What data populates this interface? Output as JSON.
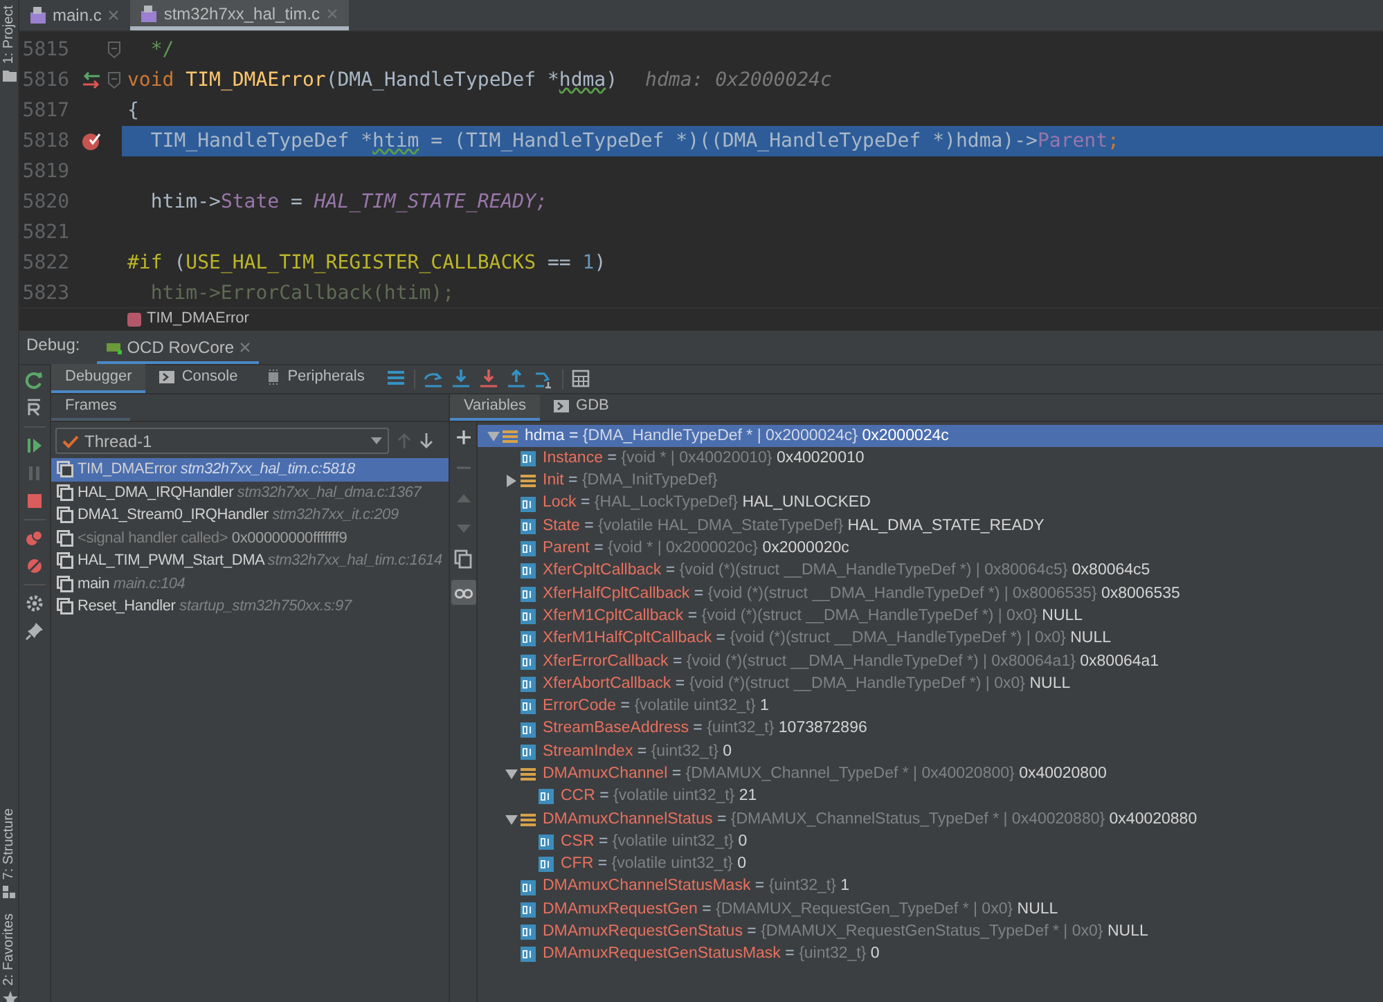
{
  "side_strip": [
    {
      "label": "1: Project",
      "kind": "project"
    },
    {
      "label": "7: Structure",
      "kind": "structure"
    },
    {
      "label": "2: Favorites",
      "kind": "favorites"
    }
  ],
  "editor": {
    "tabs": [
      {
        "label": "main.c",
        "selected": false
      },
      {
        "label": "stm32h7xx_hal_tim.c",
        "selected": true
      }
    ],
    "lines": [
      {
        "number": "5815",
        "execution_point": false,
        "breakpoint": false,
        "fold": true,
        "current": false,
        "tokens": [
          {
            "kind": "comment",
            "text": "  */"
          }
        ]
      },
      {
        "number": "5816",
        "execution_point": true,
        "breakpoint": false,
        "fold": true,
        "current": false,
        "tokens": [
          {
            "kind": "keyword",
            "text": "void "
          },
          {
            "kind": "function",
            "text": "TIM_DMAError"
          },
          {
            "kind": "plain",
            "text": "(DMA_HandleTypeDef *"
          },
          {
            "kind": "warn",
            "text": "hdma"
          },
          {
            "kind": "plain",
            "text": ")"
          },
          {
            "kind": "hint",
            "text": "hdma: 0x2000024c"
          }
        ]
      },
      {
        "number": "5817",
        "execution_point": false,
        "breakpoint": false,
        "fold": false,
        "current": false,
        "tokens": [
          {
            "kind": "plain",
            "text": "{"
          }
        ]
      },
      {
        "number": "5818",
        "execution_point": false,
        "breakpoint": true,
        "fold": false,
        "current": true,
        "tokens": [
          {
            "kind": "plain",
            "text": "  TIM_HandleTypeDef *"
          },
          {
            "kind": "warn",
            "text": "htim"
          },
          {
            "kind": "plain",
            "text": " = (TIM_HandleTypeDef *)((DMA_HandleTypeDef *)hdma)->"
          },
          {
            "kind": "field",
            "text": "Parent"
          },
          {
            "kind": "keyword",
            "text": ";"
          }
        ]
      },
      {
        "number": "5819",
        "execution_point": false,
        "breakpoint": false,
        "fold": false,
        "current": false
      },
      {
        "number": "5820",
        "execution_point": false,
        "breakpoint": false,
        "fold": false,
        "current": false,
        "tokens": [
          {
            "kind": "plain",
            "text": "  htim->"
          },
          {
            "kind": "field",
            "text": "State"
          },
          {
            "kind": "plain",
            "text": " = "
          },
          {
            "kind": "constant",
            "text": "HAL_TIM_STATE_READY;"
          }
        ]
      },
      {
        "number": "5821",
        "execution_point": false,
        "breakpoint": false,
        "fold": false,
        "current": false
      },
      {
        "number": "5822",
        "execution_point": false,
        "breakpoint": false,
        "fold": false,
        "current": false,
        "tokens": [
          {
            "kind": "macro",
            "text": "#if "
          },
          {
            "kind": "plain",
            "text": "("
          },
          {
            "kind": "macro",
            "text": "USE_HAL_TIM_REGISTER_CALLBACKS"
          },
          {
            "kind": "plain",
            "text": " == "
          },
          {
            "kind": "number",
            "text": "1"
          },
          {
            "kind": "plain",
            "text": ")"
          }
        ]
      },
      {
        "number": "5823",
        "execution_point": false,
        "breakpoint": false,
        "fold": false,
        "current": false,
        "tokens": [
          {
            "kind": "inactive",
            "text": "  htim->ErrorCallback(htim);"
          }
        ]
      }
    ],
    "breadcrumb": "TIM_DMAError"
  },
  "debug": {
    "label": "Debug:",
    "session": "OCD RovCore",
    "tabs": [
      {
        "label": "Debugger",
        "kind": "debugger",
        "selected": true
      },
      {
        "label": "Console",
        "kind": "console",
        "selected": false
      },
      {
        "label": "Peripherals",
        "kind": "peripherals",
        "selected": false
      }
    ],
    "frames": {
      "title": "Frames",
      "thread": "Thread-1",
      "items": [
        {
          "function": "TIM_DMAError",
          "location": "stm32h7xx_hal_tim.c:5818",
          "kind": "frame",
          "selected": true
        },
        {
          "function": "HAL_DMA_IRQHandler",
          "location": "stm32h7xx_hal_dma.c:1367",
          "kind": "frame",
          "selected": false
        },
        {
          "function": "DMA1_Stream0_IRQHandler",
          "location": "stm32h7xx_it.c:209",
          "kind": "frame",
          "selected": false
        },
        {
          "function": "<signal handler called>",
          "location": "0x00000000fffffff9",
          "kind": "signal",
          "selected": false
        },
        {
          "function": "HAL_TIM_PWM_Start_DMA",
          "location": "stm32h7xx_hal_tim.c:1614",
          "kind": "frame",
          "selected": false
        },
        {
          "function": "main",
          "location": "main.c:104",
          "kind": "frame",
          "selected": false
        },
        {
          "function": "Reset_Handler",
          "location": "startup_stm32h750xx.s:97",
          "kind": "frame",
          "selected": false
        }
      ]
    },
    "variables": {
      "tabs": [
        {
          "label": "Variables",
          "kind": "variables",
          "selected": true
        },
        {
          "label": "GDB",
          "kind": "gdb",
          "selected": false
        }
      ],
      "items": [
        {
          "name": "hdma",
          "separator": "=",
          "type": "{DMA_HandleTypeDef * | 0x2000024c}",
          "value": "0x2000024c",
          "kind": "struct",
          "expanded": true,
          "selected": true,
          "children": [
            {
              "name": "Instance",
              "separator": "=",
              "type": "{void * | 0x40020010}",
              "value": "0x40020010",
              "kind": "field",
              "selected": false
            },
            {
              "name": "Init",
              "separator": "=",
              "type": "{DMA_InitTypeDef}",
              "kind": "struct",
              "expanded": false,
              "selected": false
            },
            {
              "name": "Lock",
              "separator": "=",
              "type": "{HAL_LockTypeDef}",
              "value": "HAL_UNLOCKED",
              "kind": "field",
              "selected": false
            },
            {
              "name": "State",
              "separator": "=",
              "type": "{volatile HAL_DMA_StateTypeDef}",
              "value": "HAL_DMA_STATE_READY",
              "kind": "field",
              "selected": false
            },
            {
              "name": "Parent",
              "separator": "=",
              "type": "{void * | 0x2000020c}",
              "value": "0x2000020c",
              "kind": "field",
              "selected": false
            },
            {
              "name": "XferCpltCallback",
              "separator": "=",
              "type": "{void (*)(struct __DMA_HandleTypeDef *) | 0x80064c5}",
              "value": "0x80064c5",
              "kind": "field",
              "selected": false
            },
            {
              "name": "XferHalfCpltCallback",
              "separator": "=",
              "type": "{void (*)(struct __DMA_HandleTypeDef *) | 0x8006535}",
              "value": "0x8006535",
              "kind": "field",
              "selected": false
            },
            {
              "name": "XferM1CpltCallback",
              "separator": "=",
              "type": "{void (*)(struct __DMA_HandleTypeDef *) | 0x0}",
              "value": "NULL",
              "kind": "field",
              "selected": false
            },
            {
              "name": "XferM1HalfCpltCallback",
              "separator": "=",
              "type": "{void (*)(struct __DMA_HandleTypeDef *) | 0x0}",
              "value": "NULL",
              "kind": "field",
              "selected": false
            },
            {
              "name": "XferErrorCallback",
              "separator": "=",
              "type": "{void (*)(struct __DMA_HandleTypeDef *) | 0x80064a1}",
              "value": "0x80064a1",
              "kind": "field",
              "selected": false
            },
            {
              "name": "XferAbortCallback",
              "separator": "=",
              "type": "{void (*)(struct __DMA_HandleTypeDef *) | 0x0}",
              "value": "NULL",
              "kind": "field",
              "selected": false
            },
            {
              "name": "ErrorCode",
              "separator": "=",
              "type": "{volatile uint32_t}",
              "value": "1",
              "kind": "field",
              "selected": false
            },
            {
              "name": "StreamBaseAddress",
              "separator": "=",
              "type": "{uint32_t}",
              "value": "1073872896",
              "kind": "field",
              "selected": false
            },
            {
              "name": "StreamIndex",
              "separator": "=",
              "type": "{uint32_t}",
              "value": "0",
              "kind": "field",
              "selected": false
            },
            {
              "name": "DMAmuxChannel",
              "separator": "=",
              "type": "{DMAMUX_Channel_TypeDef * | 0x40020800}",
              "value": "0x40020800",
              "kind": "struct",
              "expanded": true,
              "selected": false,
              "children": [
                {
                  "name": "CCR",
                  "separator": "=",
                  "type": "{volatile uint32_t}",
                  "value": "21",
                  "kind": "field",
                  "selected": false
                }
              ]
            },
            {
              "name": "DMAmuxChannelStatus",
              "separator": "=",
              "type": "{DMAMUX_ChannelStatus_TypeDef * | 0x40020880}",
              "value": "0x40020880",
              "kind": "struct",
              "expanded": true,
              "selected": false,
              "children": [
                {
                  "name": "CSR",
                  "separator": "=",
                  "type": "{volatile uint32_t}",
                  "value": "0",
                  "kind": "field",
                  "selected": false
                },
                {
                  "name": "CFR",
                  "separator": "=",
                  "type": "{volatile uint32_t}",
                  "value": "0",
                  "kind": "field",
                  "selected": false
                }
              ]
            },
            {
              "name": "DMAmuxChannelStatusMask",
              "separator": "=",
              "type": "{uint32_t}",
              "value": "1",
              "kind": "field",
              "selected": false
            },
            {
              "name": "DMAmuxRequestGen",
              "separator": "=",
              "type": "{DMAMUX_RequestGen_TypeDef * | 0x0}",
              "value": "NULL",
              "kind": "field",
              "selected": false
            },
            {
              "name": "DMAmuxRequestGenStatus",
              "separator": "=",
              "type": "{DMAMUX_RequestGenStatus_TypeDef * | 0x0}",
              "value": "NULL",
              "kind": "field",
              "selected": false
            },
            {
              "name": "DMAmuxRequestGenStatusMask",
              "separator": "=",
              "type": "{uint32_t}",
              "value": "0",
              "kind": "field",
              "selected": false
            }
          ]
        }
      ]
    }
  }
}
